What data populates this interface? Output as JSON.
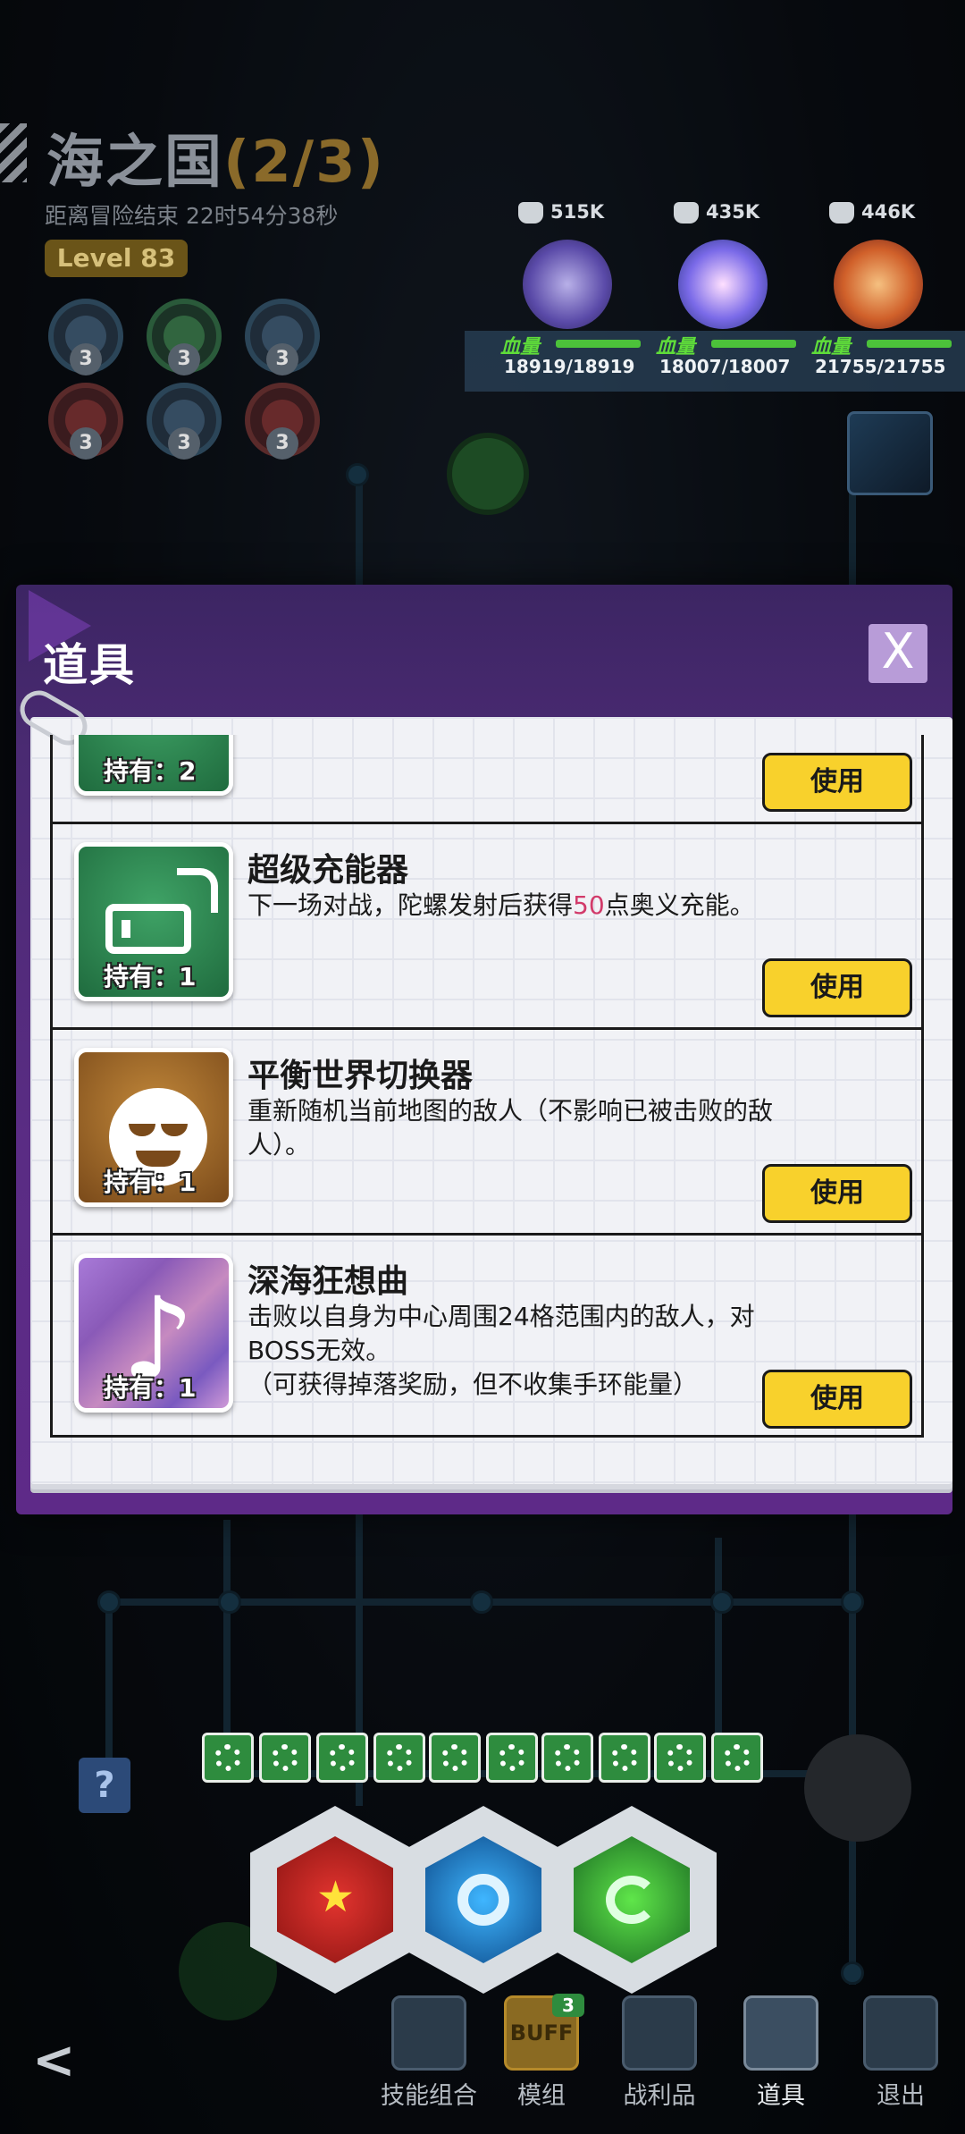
{
  "header": {
    "area_name": "海之国",
    "area_progress": "(2/3)",
    "countdown": "距离冒险结束 22时54分38秒",
    "level": "Level 83",
    "buffs": [
      {
        "icon": "shield-cat-icon",
        "count": "3",
        "color": "blue"
      },
      {
        "icon": "recycle-icon",
        "count": "3",
        "color": "green"
      },
      {
        "icon": "cluster-icon",
        "count": "3",
        "color": "blue"
      },
      {
        "icon": "arrow-burst-icon",
        "count": "3",
        "color": "red"
      },
      {
        "icon": "vortex-icon",
        "count": "3",
        "color": "blue"
      },
      {
        "icon": "rose-icon",
        "count": "3",
        "color": "red"
      }
    ]
  },
  "team": [
    {
      "power": "515K",
      "hp_label": "血量",
      "hp": "18919/18919",
      "color": "#6b5ab8"
    },
    {
      "power": "435K",
      "hp_label": "血量",
      "hp": "18007/18007",
      "color": "#5a7ad8"
    },
    {
      "power": "446K",
      "hp_label": "血量",
      "hp": "21755/21755",
      "color": "#d0702a"
    }
  ],
  "popup": {
    "title": "道具",
    "close": "X",
    "use_label": "使用",
    "items": [
      {
        "name": "",
        "owned": "持有：2",
        "desc_before": "",
        "desc_highlight": "",
        "desc_after": "",
        "icon": "gear-icon",
        "tone": "green"
      },
      {
        "name": "超级充能器",
        "owned": "持有：1",
        "desc_before": "下一场对战，陀螺发射后获得",
        "desc_highlight": "50",
        "desc_after": "点奥义充能。",
        "icon": "power-bank-icon",
        "tone": "green"
      },
      {
        "name": "平衡世界切换器",
        "owned": "持有：1",
        "desc_before": "重新随机当前地图的敌人（不影响已被击败的敌人）。",
        "desc_highlight": "",
        "desc_after": "",
        "icon": "demon-face-icon",
        "tone": "brown"
      },
      {
        "name": "深海狂想曲",
        "owned": "持有：1",
        "desc_before": "击败以自身为中心周围24格范围内的敌人，对BOSS无效。\n（可获得掉落奖励，但不收集手环能量）",
        "desc_highlight": "",
        "desc_after": "",
        "icon": "music-note-icon",
        "tone": "purple"
      }
    ]
  },
  "hud": {
    "chips_count": 10,
    "skills": [
      {
        "icon": "star-burst-icon",
        "color": "red"
      },
      {
        "icon": "ring-core-icon",
        "color": "blue"
      },
      {
        "icon": "swirl-icon",
        "color": "green"
      }
    ],
    "nav": [
      {
        "label": "技能组合",
        "icon": "hexagon-cluster-icon"
      },
      {
        "label": "模组",
        "icon": "buff-module-icon",
        "badge": "3",
        "ico_text": "BUFF"
      },
      {
        "label": "战利品",
        "icon": "loot-bag-icon"
      },
      {
        "label": "道具",
        "icon": "items-bag-icon",
        "active": true
      },
      {
        "label": "退出",
        "icon": "exit-door-icon"
      }
    ],
    "help": "?",
    "back": "<"
  }
}
